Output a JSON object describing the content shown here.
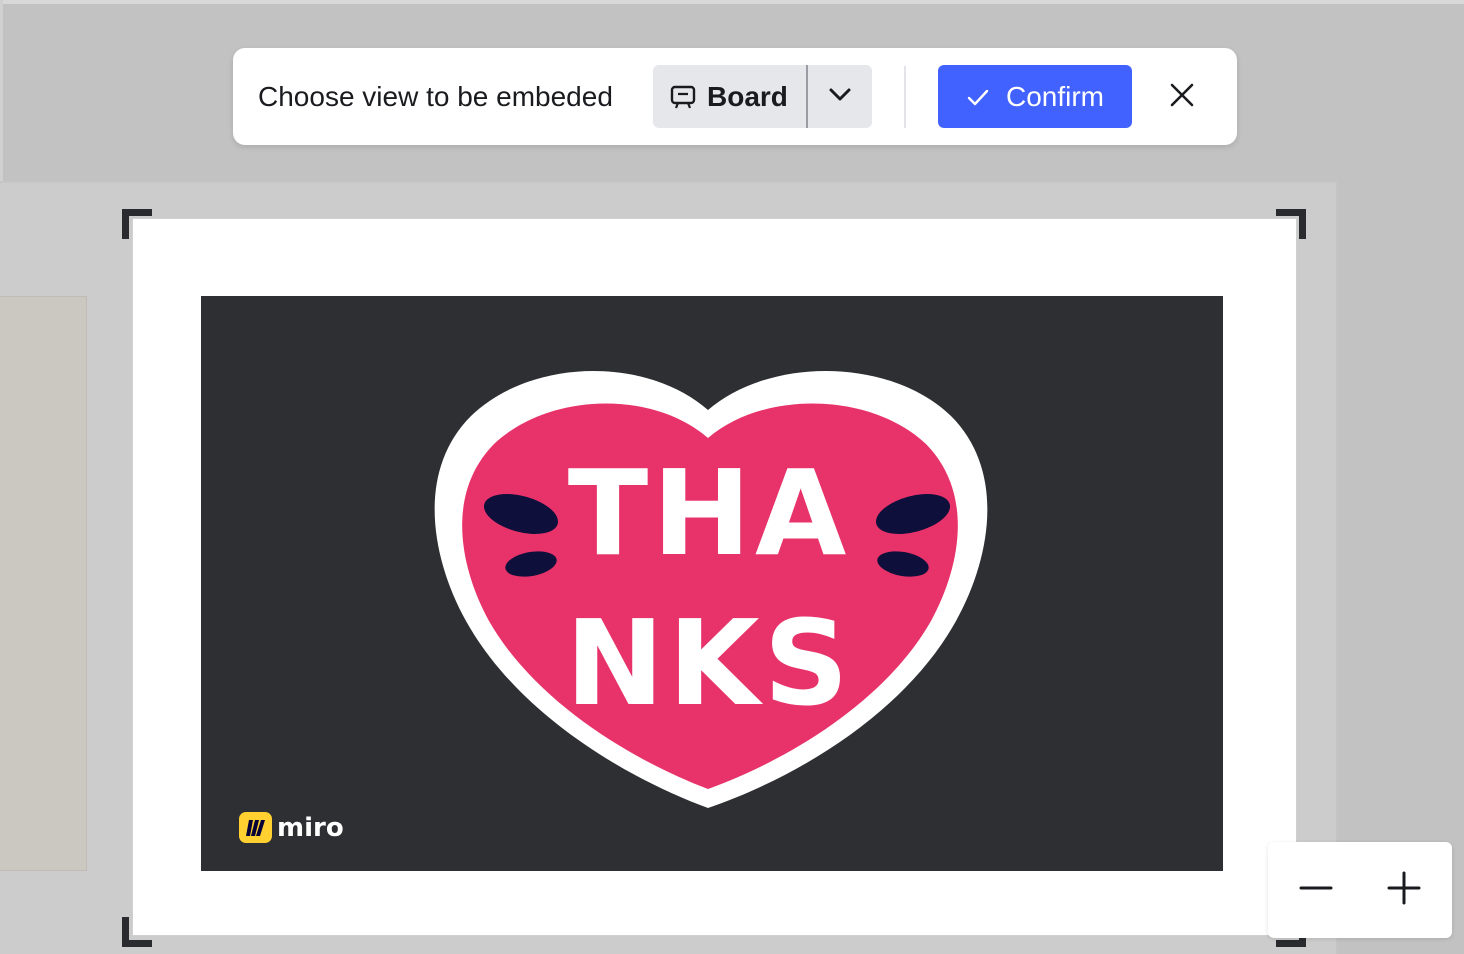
{
  "toolbar": {
    "label": "Choose view to be embeded",
    "view_select": {
      "selected_label": "Board",
      "icon": "board-icon",
      "toggle_icon": "chevron-down-icon"
    },
    "confirm_label": "Confirm",
    "confirm_icon": "check-icon",
    "close_icon": "close-icon"
  },
  "image": {
    "heart_text_line1": "THA",
    "heart_text_line2": "NKS",
    "logo_text": "miro"
  },
  "zoom": {
    "zoom_out_icon": "minus-icon",
    "zoom_in_icon": "plus-icon"
  },
  "colors": {
    "accent": "#4262ff",
    "heart": "#e8336a",
    "image_bg": "#2e2f33",
    "miro_yellow": "#ffd02f"
  }
}
